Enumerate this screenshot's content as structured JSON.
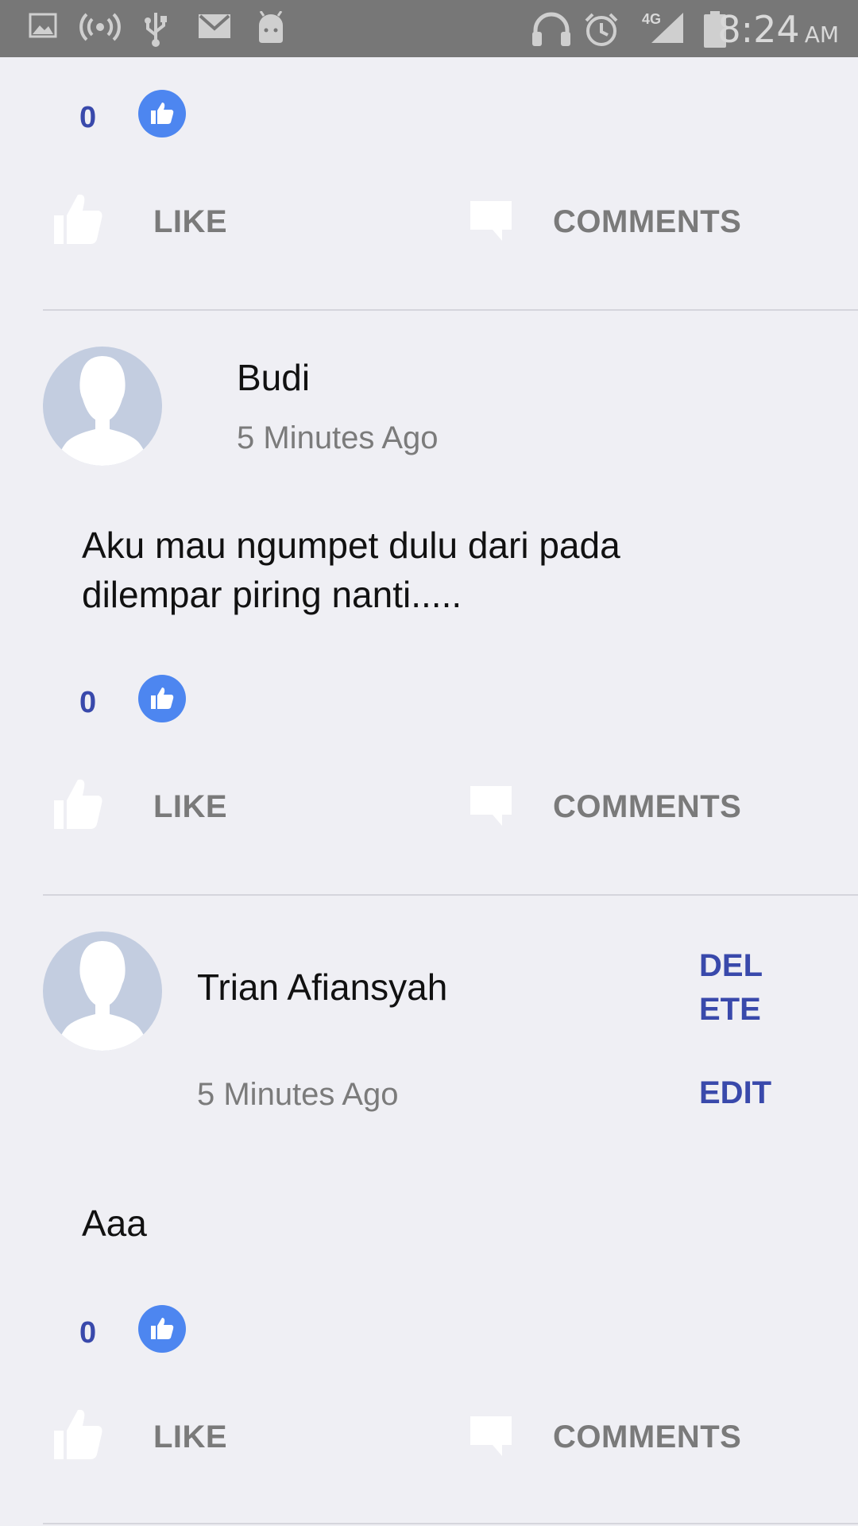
{
  "status_bar": {
    "time": "8:24",
    "ampm": "AM",
    "network": "4G",
    "left_icons": [
      "image-icon",
      "wireless-signal-icon",
      "usb-icon",
      "gmail-icon",
      "android-icon"
    ],
    "right_icons": [
      "headset-icon",
      "alarm-icon",
      "cell-signal-icon",
      "battery-icon"
    ]
  },
  "actions": {
    "like_label": "LIKE",
    "comments_label": "COMMENTS"
  },
  "posts": [
    {
      "like_count": "0"
    },
    {
      "author": "Budi",
      "time": "5 Minutes Ago",
      "content": "Aku mau ngumpet dulu dari pada dilempar piring nanti.....",
      "like_count": "0"
    },
    {
      "author": "Trian Afiansyah",
      "time": "5 Minutes Ago",
      "content": "Aaa",
      "like_count": "0",
      "delete_label": "DEL\nETE",
      "edit_label": "EDIT"
    }
  ],
  "colors": {
    "accent": "#3949ab",
    "like_bubble": "#4d86f0",
    "background": "#efeff4",
    "status_bar": "#777777"
  }
}
